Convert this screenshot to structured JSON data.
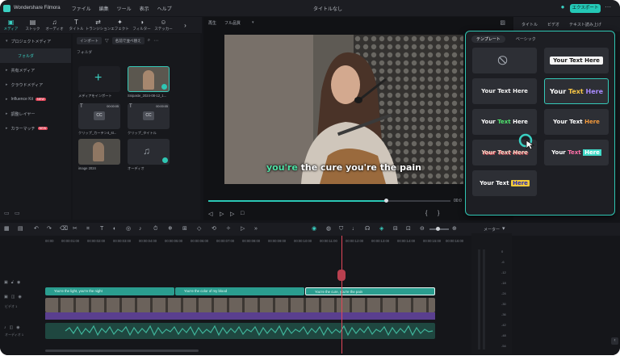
{
  "app": {
    "name": "Wondershare Filmora",
    "window_title": "タイトルなし",
    "export_label": "エクスポート"
  },
  "menu": [
    "ファイル",
    "編集",
    "ツール",
    "表示",
    "ヘルプ"
  ],
  "toolbar_tabs": [
    {
      "label": "メディア",
      "icon": "media-icon"
    },
    {
      "label": "ストック",
      "icon": "stock-icon"
    },
    {
      "label": "オーディオ",
      "icon": "music-icon"
    },
    {
      "label": "タイトル",
      "icon": "title-icon"
    },
    {
      "label": "トランジション",
      "icon": "transition-icon"
    },
    {
      "label": "エフェクト",
      "icon": "effects-icon"
    },
    {
      "label": "フィルター",
      "icon": "filter-icon"
    },
    {
      "label": "ステッカー",
      "icon": "sticker-icon"
    }
  ],
  "sidebar": {
    "items": [
      "プロジェクトメディア",
      "フォルダ",
      "共有メディア",
      "クラウドメディア",
      "Influence Kit",
      "調整レイヤー",
      "カラーマッチ"
    ],
    "new_badge": "NEW"
  },
  "media": {
    "import_label": "インポート",
    "sort_label": "名前で並べ替え",
    "folder_label": "フォルダ",
    "items": [
      {
        "label": "メディアをインポート"
      },
      {
        "label": "Snipaste_2024-08-12_1..."
      },
      {
        "label": "クリップ_カーテン4_st..."
      },
      {
        "label": "クリップ_タイトル"
      },
      {
        "label": "image 2024"
      },
      {
        "label": "オーディオ"
      }
    ],
    "badge_time": "00:00:05"
  },
  "preview": {
    "mode_label": "再生",
    "quality_label": "フル品質",
    "caption_highlight": "you're",
    "caption_rest": " the cure you're the pain",
    "time": "00:0"
  },
  "right_tabs": [
    "タイトル",
    "ビデオ",
    "テキスト読み上げ"
  ],
  "title_panel": {
    "tabs": [
      "テンプレート",
      "ベーシック"
    ],
    "tiles": [
      {
        "text": "",
        "style": "none"
      },
      {
        "text": "Your Text Here",
        "style": "box"
      },
      {
        "text": "Your Text Here",
        "style": "white"
      },
      {
        "text": "Your Text Here",
        "style": "tricolor"
      },
      {
        "text": "Your Text Here",
        "style": "green"
      },
      {
        "text": "Your Text Here",
        "style": "orange"
      },
      {
        "text": "Your Text Here",
        "style": "red-italic"
      },
      {
        "text": "Your Text Here",
        "style": "pink-teal"
      },
      {
        "text": "Your Text Here",
        "style": "yellow-box"
      }
    ]
  },
  "colors": {
    "accent": "#2fc6b3",
    "playhead": "#e2475a",
    "caption_highlight": "#4fe3a6"
  },
  "timeline": {
    "ruler": [
      "00:00",
      "00:00:01:00",
      "00:00:02:00",
      "00:00:03:00",
      "00:00:04:00",
      "00:00:05:00",
      "00:00:06:00",
      "00:00:07:00",
      "00:00:08:00",
      "00:00:09:00",
      "00:00:10:00",
      "00:00:11:00",
      "00:00:12:00",
      "00:00:13:00",
      "00:00:14:00",
      "00:00:15:00",
      "00:00:16:00",
      "00:00:17:00",
      "00:00:18:00"
    ],
    "subtitle_clips": [
      "You're the light, you're the night",
      "You're the color of my blood",
      "You're the cure, you're the pain"
    ],
    "video_track_label": "ビデオ 1",
    "audio_track_label": "オーディオ 1",
    "meter_label": "メーター",
    "meter_scale": [
      "0",
      "-6",
      "-12",
      "-18",
      "-24",
      "-30",
      "-36",
      "-42",
      "-48",
      "-54"
    ]
  }
}
